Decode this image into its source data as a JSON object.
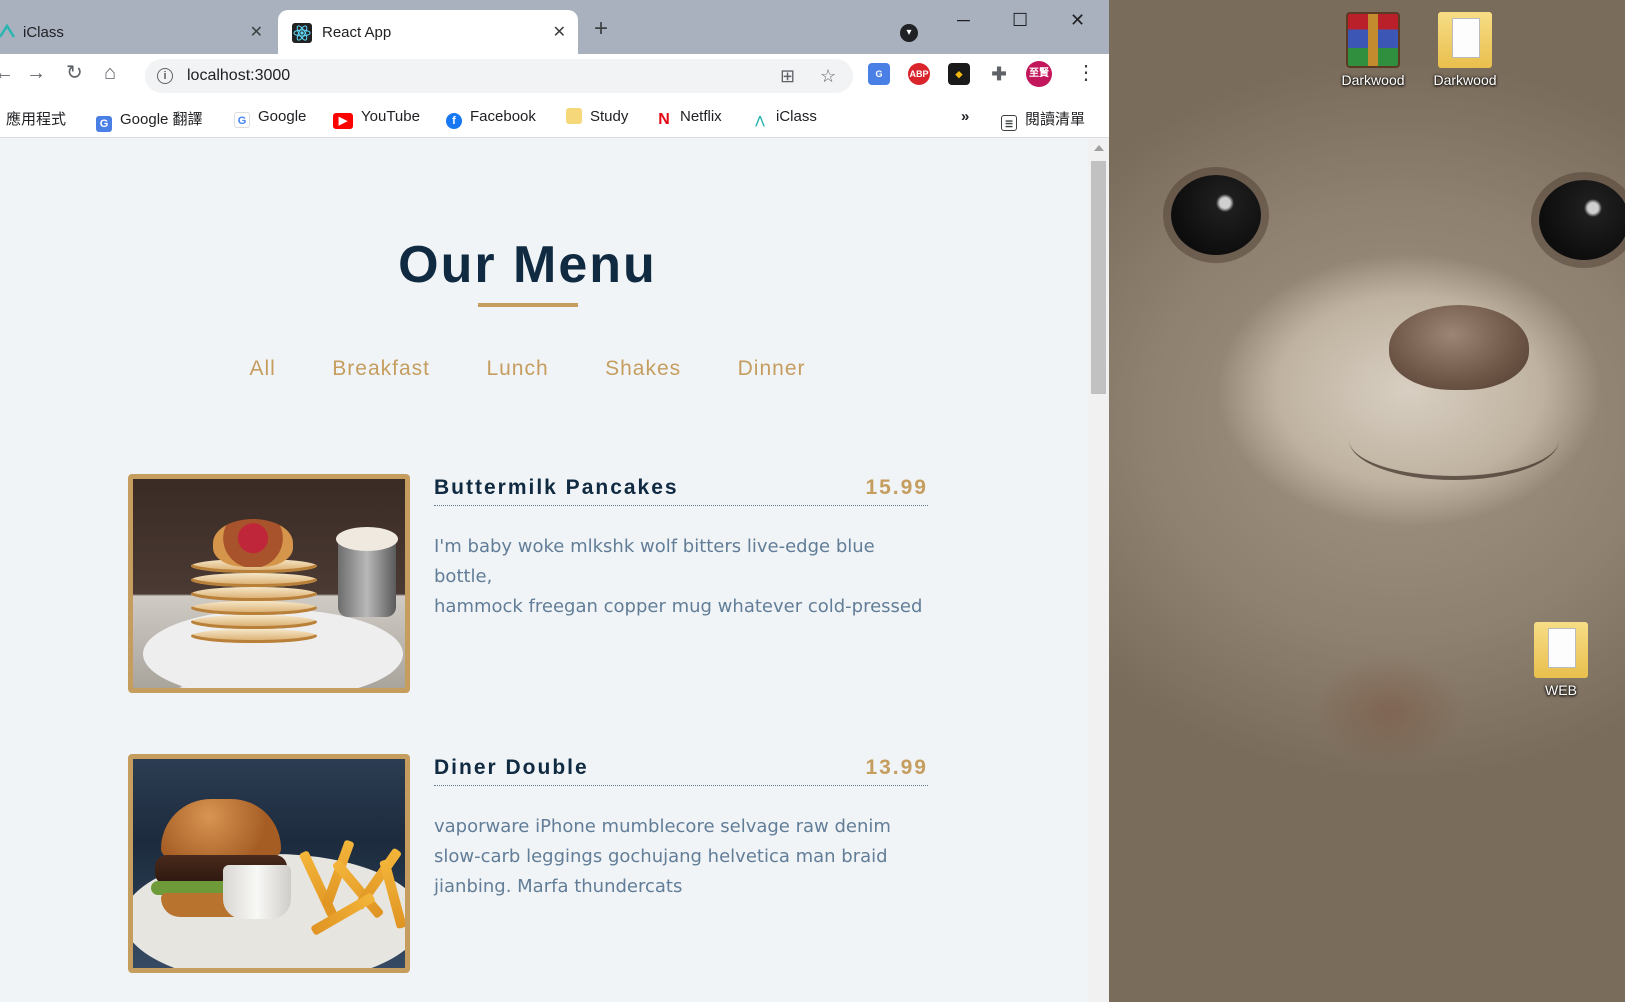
{
  "browser": {
    "tabs": [
      {
        "title": "iClass",
        "active": false
      },
      {
        "title": "React App",
        "active": true
      }
    ],
    "url": "localhost:3000",
    "bookmarks": [
      {
        "label": "應用程式",
        "icon": "apps-icon"
      },
      {
        "label": "Google 翻譯",
        "icon": "google-translate-icon"
      },
      {
        "label": "Google",
        "icon": "google-icon"
      },
      {
        "label": "YouTube",
        "icon": "youtube-icon"
      },
      {
        "label": "Facebook",
        "icon": "facebook-icon"
      },
      {
        "label": "Study",
        "icon": "folder-icon"
      },
      {
        "label": "Netflix",
        "icon": "netflix-icon"
      },
      {
        "label": "iClass",
        "icon": "iclass-icon"
      }
    ],
    "overflow": "»",
    "reading_list": "閱讀清單",
    "profile_label": "至賢",
    "abp_label": "ABP"
  },
  "page": {
    "title": "Our Menu",
    "filters": [
      "All",
      "Breakfast",
      "Lunch",
      "Shakes",
      "Dinner"
    ],
    "items": [
      {
        "name": "Buttermilk Pancakes",
        "price": "15.99",
        "desc_line1": "I'm baby woke mlkshk wolf bitters live-edge blue bottle,",
        "desc_line2": "hammock freegan copper mug whatever cold-pressed",
        "image": "pancakes-photo"
      },
      {
        "name": "Diner Double",
        "price": "13.99",
        "desc_line1": "vaporware iPhone mumblecore selvage raw denim",
        "desc_line2": "slow-carb leggings gochujang helvetica man braid",
        "desc_line3": "jianbing. Marfa thundercats",
        "image": "burger-photo"
      }
    ]
  },
  "desktop": {
    "icons": [
      {
        "label": "Darkwood",
        "icon": "winrar-icon"
      },
      {
        "label": "Darkwood",
        "icon": "folder-icon"
      },
      {
        "label": "WEB",
        "icon": "folder-icon"
      }
    ]
  },
  "colors": {
    "accent": "#c59d5f",
    "heading": "#102a42",
    "body_text": "#617d98",
    "background": "#f1f4f6"
  }
}
